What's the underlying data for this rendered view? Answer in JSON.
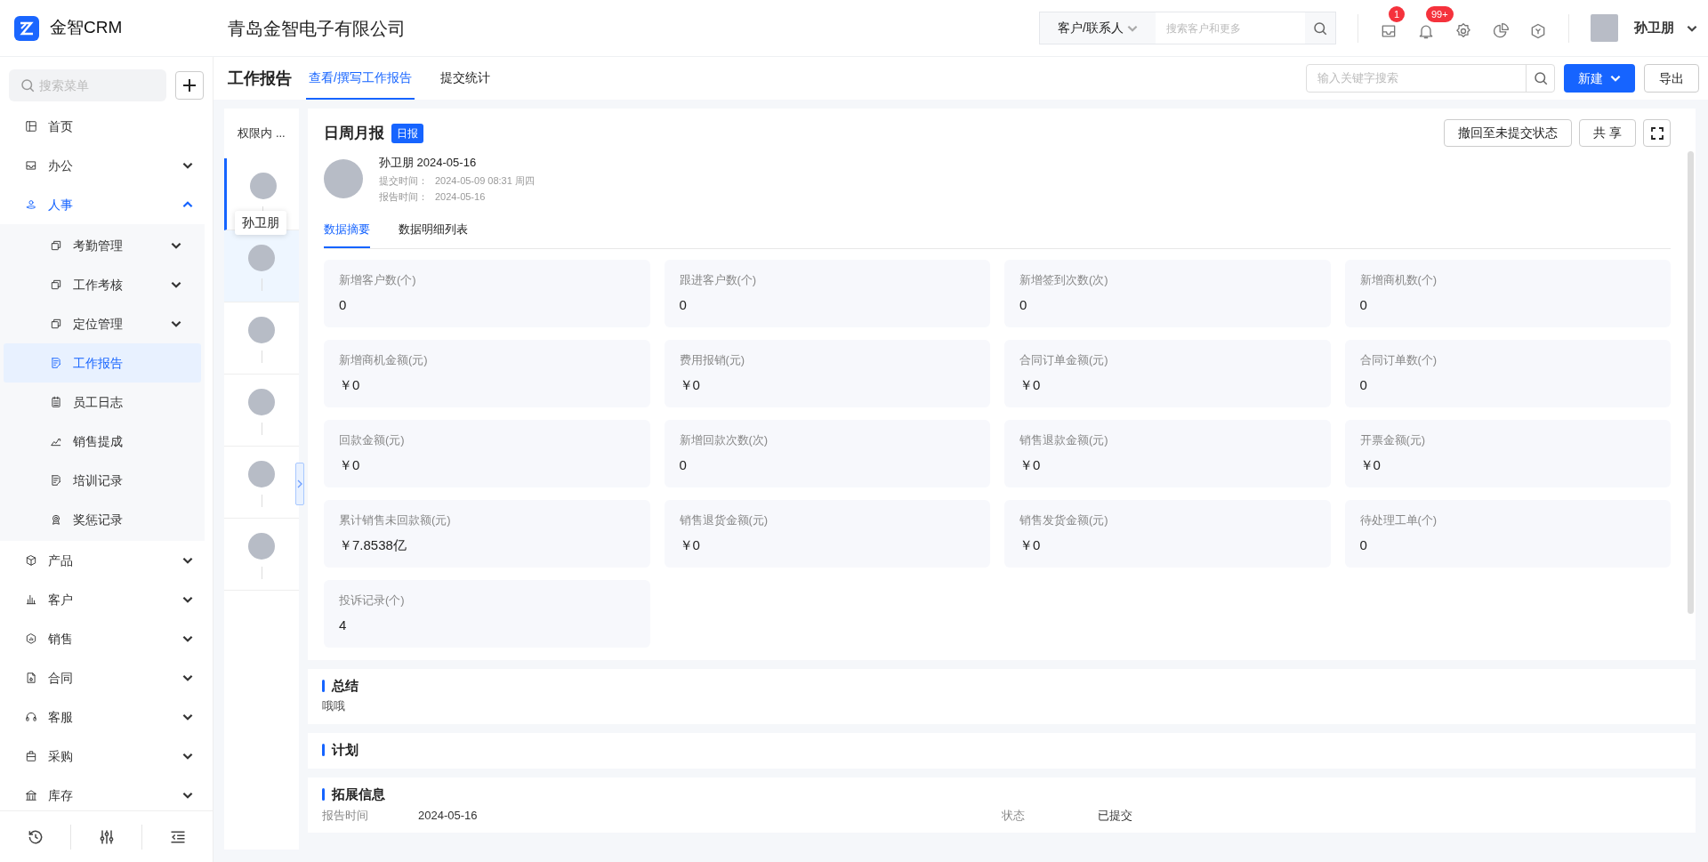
{
  "app": {
    "name": "金智CRM"
  },
  "company": "青岛金智电子有限公司",
  "global_search": {
    "scope": "客户/联系人",
    "placeholder": "搜索客户和更多"
  },
  "header_icons": [
    {
      "kind": "tray",
      "badge": "1"
    },
    {
      "kind": "bell",
      "badge": "99+"
    },
    {
      "kind": "gear"
    },
    {
      "kind": "pie"
    },
    {
      "kind": "cube"
    }
  ],
  "user": {
    "name": "孙卫朋"
  },
  "sidebar": {
    "search_placeholder": "搜索菜单",
    "items": [
      {
        "label": "首页",
        "kind": "layout",
        "selected": false
      },
      {
        "label": "办公",
        "kind": "tray",
        "selected": false,
        "expanded": false
      },
      {
        "label": "人事",
        "kind": "person",
        "selected": true,
        "expanded": true,
        "children": [
          {
            "label": "考勤管理",
            "kind": "copy",
            "selected": false,
            "expanded": false
          },
          {
            "label": "工作考核",
            "kind": "copy",
            "selected": false,
            "expanded": false
          },
          {
            "label": "定位管理",
            "kind": "copy",
            "selected": false,
            "expanded": false
          },
          {
            "label": "工作报告",
            "kind": "doc",
            "selected": true
          },
          {
            "label": "员工日志",
            "kind": "calendar",
            "selected": false
          },
          {
            "label": "销售提成",
            "kind": "chart",
            "selected": false
          },
          {
            "label": "培训记录",
            "kind": "doc",
            "selected": false
          },
          {
            "label": "奖惩记录",
            "kind": "medal",
            "selected": false
          }
        ]
      },
      {
        "label": "产品",
        "kind": "cube",
        "selected": false,
        "expanded": false
      },
      {
        "label": "客户",
        "kind": "bars",
        "selected": false,
        "expanded": false
      },
      {
        "label": "销售",
        "kind": "hexagon",
        "selected": false,
        "expanded": false
      },
      {
        "label": "合同",
        "kind": "file",
        "selected": false,
        "expanded": false
      },
      {
        "label": "客服",
        "kind": "headset",
        "selected": false,
        "expanded": false
      },
      {
        "label": "采购",
        "kind": "bag",
        "selected": false,
        "expanded": false
      },
      {
        "label": "库存",
        "kind": "bank",
        "selected": false,
        "expanded": false
      }
    ]
  },
  "page": {
    "title": "工作报告",
    "tabs": [
      {
        "label": "查看/撰写工作报告",
        "selected": true
      },
      {
        "label": "提交统计",
        "selected": false
      }
    ],
    "search_placeholder": "输入关键字搜索",
    "new_button": "新建",
    "export_button": "导出"
  },
  "report_list": {
    "header": "权限内 ...",
    "tooltip": "孙卫朋",
    "items": [
      {
        "selected": true,
        "hovered": false
      },
      {
        "selected": false,
        "hovered": true
      },
      {
        "selected": false,
        "hovered": false
      },
      {
        "selected": false,
        "hovered": false
      },
      {
        "selected": false,
        "hovered": false
      },
      {
        "selected": false,
        "hovered": false
      }
    ]
  },
  "report": {
    "title": "日周月报",
    "badge": "日报",
    "actions": [
      "撤回至未提交状态",
      "共 享"
    ],
    "author_line": "孙卫朋 2024-05-16",
    "meta": [
      {
        "label": "提交时间：",
        "value": "2024-05-09 08:31 周四"
      },
      {
        "label": "报告时间：",
        "value": "2024-05-16"
      }
    ],
    "tabs": [
      {
        "label": "数据摘要",
        "selected": true
      },
      {
        "label": "数据明细列表",
        "selected": false
      }
    ],
    "stats": [
      {
        "label": "新增客户数(个)",
        "value": "0"
      },
      {
        "label": "跟进客户数(个)",
        "value": "0"
      },
      {
        "label": "新增签到次数(次)",
        "value": "0"
      },
      {
        "label": "新增商机数(个)",
        "value": "0"
      },
      {
        "label": "新增商机金额(元)",
        "value": "￥0"
      },
      {
        "label": "费用报销(元)",
        "value": "￥0"
      },
      {
        "label": "合同订单金额(元)",
        "value": "￥0"
      },
      {
        "label": "合同订单数(个)",
        "value": "0"
      },
      {
        "label": "回款金额(元)",
        "value": "￥0"
      },
      {
        "label": "新增回款次数(次)",
        "value": "0"
      },
      {
        "label": "销售退款金额(元)",
        "value": "￥0"
      },
      {
        "label": "开票金额(元)",
        "value": "￥0"
      },
      {
        "label": "累计销售未回款额(元)",
        "value": "￥7.8538亿"
      },
      {
        "label": "销售退货金额(元)",
        "value": "￥0"
      },
      {
        "label": "销售发货金额(元)",
        "value": "￥0"
      },
      {
        "label": "待处理工单(个)",
        "value": "0"
      },
      {
        "label": "投诉记录(个)",
        "value": "4"
      }
    ],
    "sections": [
      {
        "title": "总结",
        "text": "哦哦"
      },
      {
        "title": "计划"
      },
      {
        "title": "拓展信息",
        "fields": [
          {
            "label": "报告时间",
            "value": "2024-05-16"
          },
          {
            "label": "状态",
            "value": "已提交"
          }
        ]
      }
    ]
  }
}
